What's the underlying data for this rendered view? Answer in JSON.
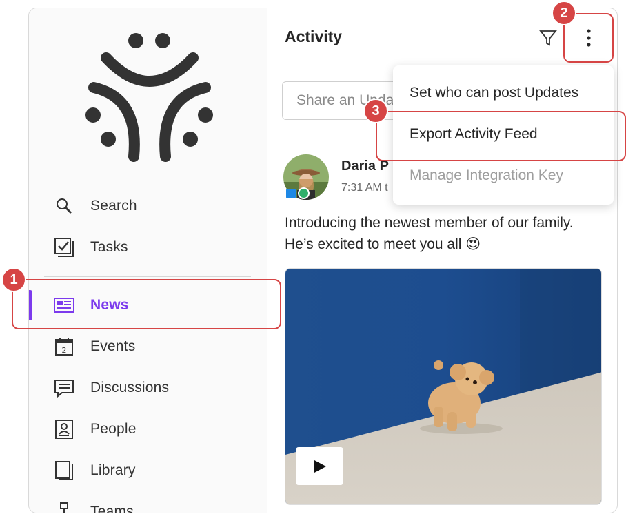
{
  "sidebar": {
    "items": [
      {
        "label": "Search",
        "icon": "search-icon"
      },
      {
        "label": "Tasks",
        "icon": "tasks-icon"
      },
      {
        "label": "News",
        "icon": "news-icon",
        "active": true
      },
      {
        "label": "Events",
        "icon": "calendar-icon"
      },
      {
        "label": "Discussions",
        "icon": "discussions-icon"
      },
      {
        "label": "People",
        "icon": "people-icon"
      },
      {
        "label": "Library",
        "icon": "library-icon"
      },
      {
        "label": "Teams",
        "icon": "teams-icon"
      }
    ]
  },
  "header": {
    "title": "Activity"
  },
  "share": {
    "placeholder": "Share an Update"
  },
  "post": {
    "author": "Daria P",
    "time": "7:31 AM t",
    "text": "Introducing the newest member of our family. He’s excited to meet you all 😍"
  },
  "menu": {
    "items": [
      {
        "label": "Set who can post Updates",
        "enabled": true
      },
      {
        "label": "Export Activity Feed",
        "enabled": true
      },
      {
        "label": "Manage Integration Key",
        "enabled": false
      }
    ]
  },
  "callouts": [
    "1",
    "2",
    "3"
  ],
  "colors": {
    "accent": "#7c3aed",
    "callout": "#d64545",
    "online": "#2faf6a"
  }
}
